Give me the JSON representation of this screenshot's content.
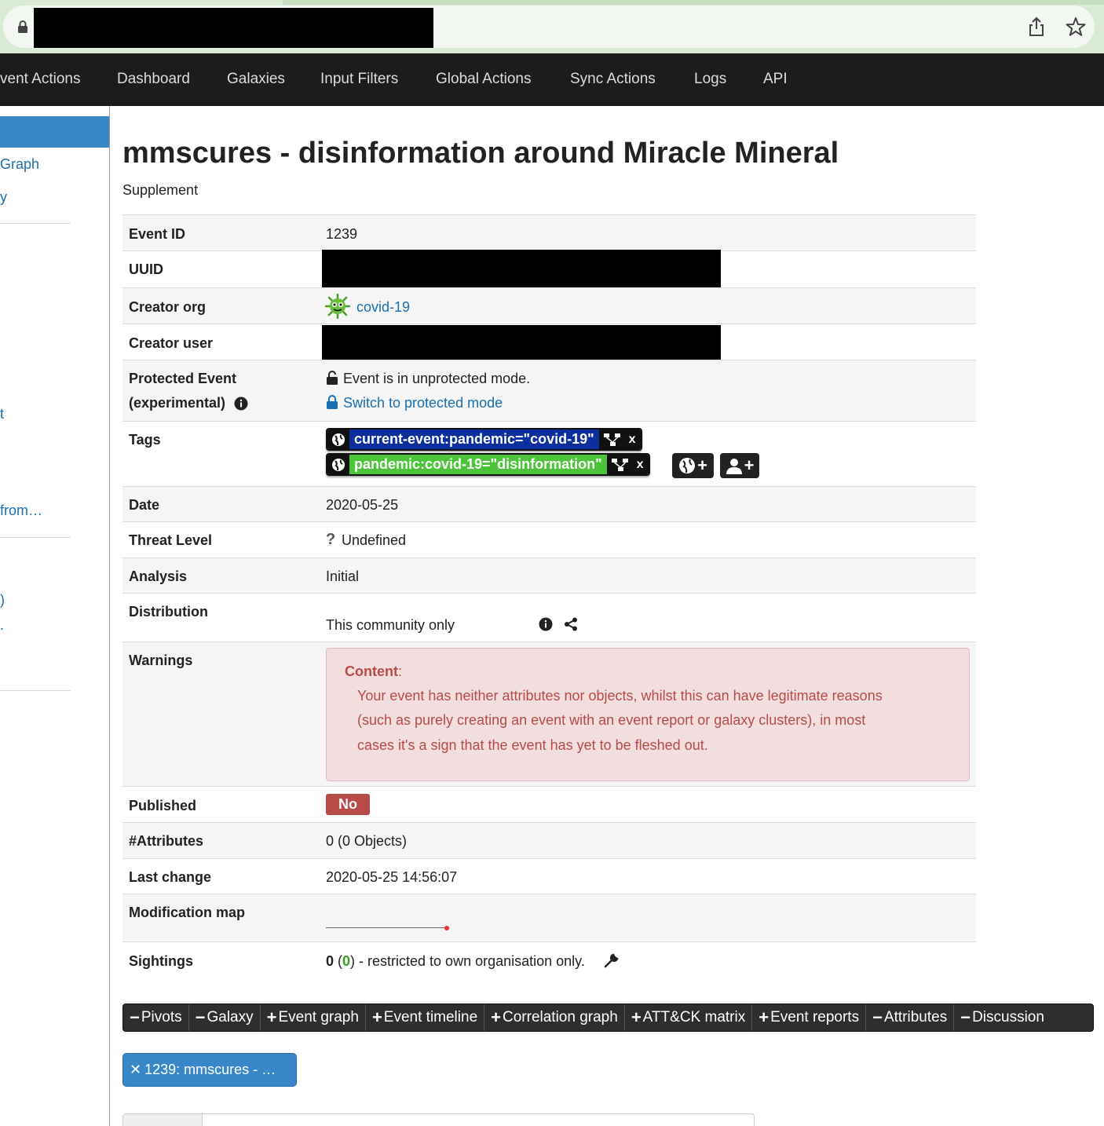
{
  "browser": {
    "lock_icon": "lock-icon",
    "share_icon": "share-icon",
    "star_icon": "star-icon"
  },
  "topnav": {
    "items": [
      "vent Actions",
      "Dashboard",
      "Galaxies",
      "Input Filters",
      "Global Actions",
      "Sync Actions",
      "Logs",
      "API"
    ]
  },
  "sidebar": {
    "links": [
      "Graph",
      "y",
      "t",
      "from…",
      ")",
      "."
    ]
  },
  "event": {
    "title": "mmscures - disinformation around Miracle Mineral",
    "subtitle": "Supplement",
    "labels": {
      "event_id": "Event ID",
      "uuid": "UUID",
      "creator_org": "Creator org",
      "creator_user": "Creator user",
      "protected_1": "Protected Event",
      "protected_2": "(experimental)",
      "tags": "Tags",
      "date": "Date",
      "threat_level": "Threat Level",
      "analysis": "Analysis",
      "distribution": "Distribution",
      "warnings": "Warnings",
      "published": "Published",
      "attributes": "#Attributes",
      "last_change": "Last change",
      "modification_map": "Modification map",
      "sightings": "Sightings"
    },
    "values": {
      "event_id": "1239",
      "creator_org": "covid-19",
      "protected_status": "Event is in unprotected mode.",
      "protected_switch": "Switch to protected mode",
      "date": "2020-05-25",
      "threat_level": "Undefined",
      "analysis": "Initial",
      "distribution": "This community only",
      "published": "No",
      "attributes": "0 (0 Objects)",
      "last_change": "2020-05-25 14:56:07",
      "sightings_count": "0",
      "sightings_paren_open": " (",
      "sightings_green": "0",
      "sightings_rest": ") - restricted to own organisation only."
    },
    "tags": [
      {
        "text": "current-event:pandemic=\"covid-19\"",
        "color": "#0d2f9e",
        "remove": "x"
      },
      {
        "text": "pandemic:covid-19=\"disinformation\"",
        "color": "#4cc43a",
        "remove": "x"
      }
    ],
    "warning": {
      "heading": "Content",
      "colon": ":",
      "line1": "Your event has neither attributes nor objects, whilst this can have legitimate reasons",
      "line2": "(such as purely creating an event with an event report or galaxy clusters), in most",
      "line3": "cases it's a sign that the event has yet to be fleshed out."
    }
  },
  "tabs": [
    {
      "sym": "−",
      "label": "Pivots"
    },
    {
      "sym": "−",
      "label": "Galaxy"
    },
    {
      "sym": "+",
      "label": "Event graph"
    },
    {
      "sym": "+",
      "label": "Event timeline"
    },
    {
      "sym": "+",
      "label": "Correlation graph"
    },
    {
      "sym": "+",
      "label": "ATT&CK matrix"
    },
    {
      "sym": "+",
      "label": "Event reports"
    },
    {
      "sym": "−",
      "label": "Attributes"
    },
    {
      "sym": "−",
      "label": "Discussion"
    }
  ],
  "pivot_tab": {
    "close": "✕",
    "label": "1239: mmscures - …"
  },
  "colors": {
    "nav_bg": "#1c1c1c",
    "link": "#1a6fb4",
    "accent": "#3a87c8",
    "danger": "#b94a48",
    "warning_bg": "#f2dede"
  }
}
